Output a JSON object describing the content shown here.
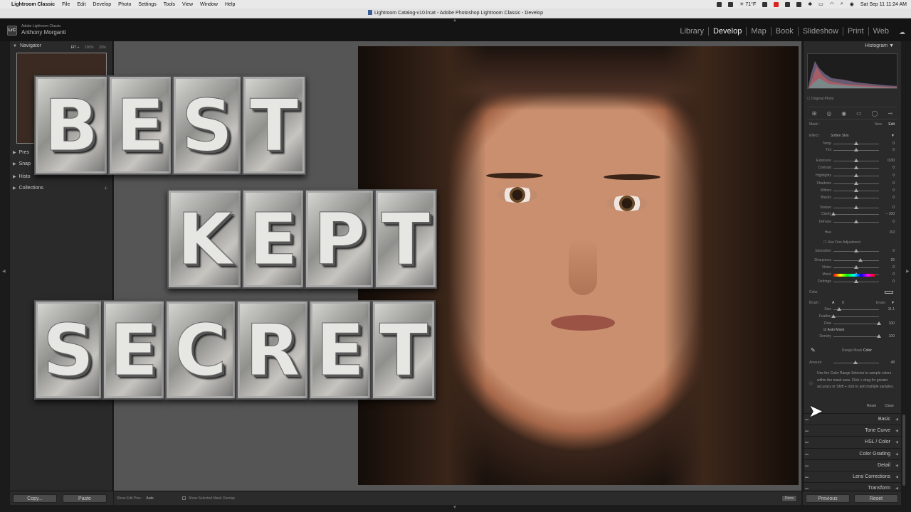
{
  "menubar": {
    "app_name": "Lightroom Classic",
    "items": [
      "File",
      "Edit",
      "Develop",
      "Photo",
      "Settings",
      "Tools",
      "View",
      "Window",
      "Help"
    ],
    "weather": "71°F",
    "datetime": "Sat Sep 11  11:24 AM"
  },
  "window": {
    "title": "Lightroom Catalog-v10.lrcat - Adobe Photoshop Lightroom Classic - Develop"
  },
  "identity": {
    "logo": "LrC",
    "app_sub": "Adobe Lightroom Classic",
    "user": "Anthony Morganti"
  },
  "modules": [
    {
      "label": "Library",
      "active": false
    },
    {
      "label": "Develop",
      "active": true
    },
    {
      "label": "Map",
      "active": false
    },
    {
      "label": "Book",
      "active": false
    },
    {
      "label": "Slideshow",
      "active": false
    },
    {
      "label": "Print",
      "active": false
    },
    {
      "label": "Web",
      "active": false
    }
  ],
  "left_panel": {
    "navigator": "Navigator",
    "nav_opts": [
      "FIT ÷",
      "100%",
      "33%"
    ],
    "presets": "Pres",
    "snapshots": "Snap",
    "history": "Histo",
    "collections": "Collections",
    "copy": "Copy...",
    "paste": "Paste"
  },
  "overlay_title": {
    "words": [
      [
        "B",
        "E",
        "S",
        "T"
      ],
      [
        "K",
        "E",
        "P",
        "T"
      ],
      [
        "S",
        "E",
        "C",
        "R",
        "E",
        "T"
      ]
    ]
  },
  "bottom_toolbar": {
    "edit_pins_label": "Show Edit Pins :",
    "edit_pins_value": "Auto",
    "overlay_label": "Show Selected Mask Overlay",
    "done": "Done"
  },
  "right_panel": {
    "histogram": "Histogram",
    "original_photo": "Original Photo",
    "mask": "Mask :",
    "mask_new": "New",
    "mask_edit": "Edit",
    "effect_label": "Effect :",
    "effect_value": "Soften Skin",
    "sliders": [
      {
        "label": "Temp",
        "value": "0",
        "pos": 0.5
      },
      {
        "label": "Tint",
        "value": "0",
        "pos": 0.5
      },
      {
        "label": "Exposure",
        "value": "0.00",
        "pos": 0.5
      },
      {
        "label": "Contrast",
        "value": "0",
        "pos": 0.5
      },
      {
        "label": "Highlights",
        "value": "0",
        "pos": 0.5
      },
      {
        "label": "Shadows",
        "value": "0",
        "pos": 0.5
      },
      {
        "label": "Whites",
        "value": "0",
        "pos": 0.5
      },
      {
        "label": "Blacks",
        "value": "0",
        "pos": 0.5
      },
      {
        "label": "Texture",
        "value": "0",
        "pos": 0.5
      },
      {
        "label": "Clarity",
        "value": "– 100",
        "pos": 0.0
      },
      {
        "label": "Dehaze",
        "value": "0",
        "pos": 0.5
      },
      {
        "label": "Hue",
        "value": "0.0",
        "pos": 0.5
      },
      {
        "label": "Saturation",
        "value": "0",
        "pos": 0.5
      },
      {
        "label": "Sharpness",
        "value": "25",
        "pos": 0.6
      },
      {
        "label": "Noise",
        "value": "0",
        "pos": 0.5
      },
      {
        "label": "Moiré",
        "value": "0",
        "pos": 0.5
      },
      {
        "label": "Defringe",
        "value": "0",
        "pos": 0.5
      }
    ],
    "fine_adjust": "Use Fine Adjustment",
    "color": "Color",
    "brush_label": "Brush :",
    "brush_a": "A",
    "brush_b": "B",
    "brush_erase": "Erase",
    "brush_sliders": [
      {
        "label": "Size",
        "value": "11.1",
        "pos": 0.12
      },
      {
        "label": "Feather",
        "value": "",
        "pos": 0.0
      },
      {
        "label": "Flow",
        "value": "100",
        "pos": 1.0
      },
      {
        "label": "Density",
        "value": "100",
        "pos": 1.0
      }
    ],
    "auto_mask": "Auto Mask",
    "range_mask_label": "Range Mask :",
    "range_mask_value": "Color",
    "amount_label": "Amount",
    "amount_value": "48",
    "amount_pos": 0.48,
    "help_text": "Use the Color Range Selector to sample colors within the mask area. Click + drag for greater accuracy or Shift + click to add multiple samples.",
    "reset": "Reset",
    "close": "Close",
    "sections": [
      "Basic",
      "Tone Curve",
      "HSL / Color",
      "Color Grading",
      "Detail",
      "Lens Corrections",
      "Transform"
    ],
    "previous": "Previous",
    "reset_btn": "Reset"
  }
}
